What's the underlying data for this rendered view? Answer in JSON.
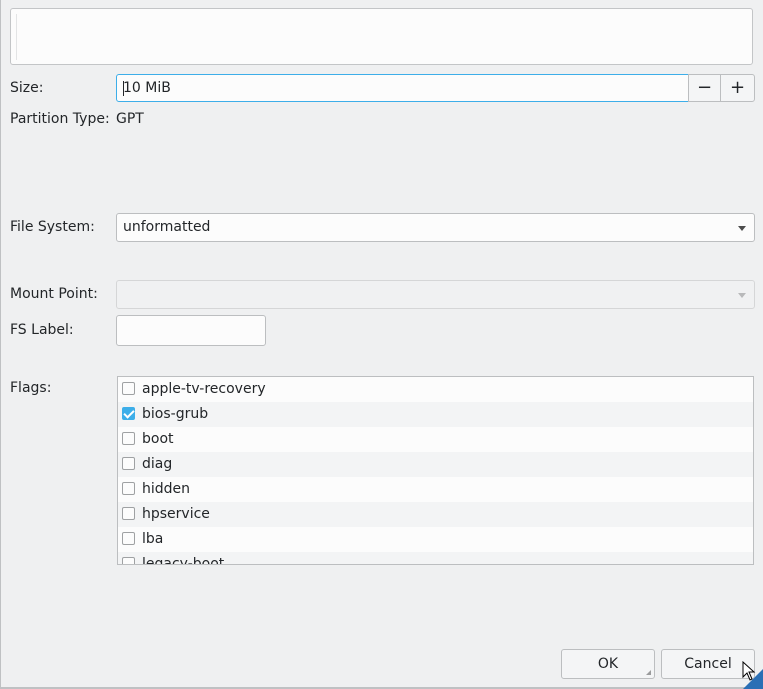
{
  "form": {
    "size_label": "Size:",
    "size_value": "10 MiB",
    "minus_symbol": "−",
    "plus_symbol": "+",
    "partition_type_label": "Partition Type:",
    "partition_type_value": "GPT",
    "file_system_label": "File System:",
    "file_system_value": "unformatted",
    "mount_point_label": "Mount Point:",
    "mount_point_value": "",
    "fs_label_label": "FS Label:",
    "fs_label_value": "",
    "flags_label": "Flags:"
  },
  "flags": [
    {
      "name": "apple-tv-recovery",
      "checked": false
    },
    {
      "name": "bios-grub",
      "checked": true
    },
    {
      "name": "boot",
      "checked": false
    },
    {
      "name": "diag",
      "checked": false
    },
    {
      "name": "hidden",
      "checked": false
    },
    {
      "name": "hpservice",
      "checked": false
    },
    {
      "name": "lba",
      "checked": false
    },
    {
      "name": "legacy-boot",
      "checked": false
    }
  ],
  "buttons": {
    "ok": "OK",
    "cancel": "Cancel"
  },
  "colors": {
    "accent": "#3daee9",
    "background": "#eff0f1"
  }
}
